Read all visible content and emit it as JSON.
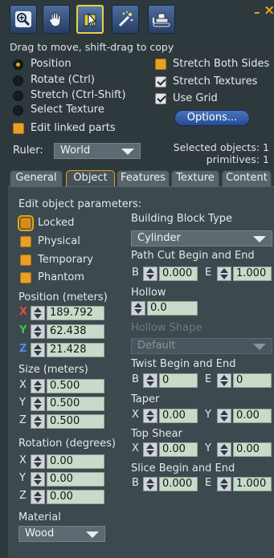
{
  "toolbar": {
    "tools": [
      {
        "icon": "magnify-icon"
      },
      {
        "icon": "grab-hand-icon"
      },
      {
        "icon": "edit-arrow-icon",
        "active": true
      },
      {
        "icon": "create-wand-icon"
      },
      {
        "icon": "bulldozer-icon"
      }
    ],
    "minimize_label": "–",
    "close_label": "×"
  },
  "hint": "Drag to move, shift-drag to copy",
  "edit_modes": [
    {
      "label": "Position",
      "selected": true
    },
    {
      "label": "Rotate (Ctrl)",
      "selected": false
    },
    {
      "label": "Stretch (Ctrl-Shift)",
      "selected": false
    },
    {
      "label": "Select Texture",
      "selected": false
    }
  ],
  "edit_linked_parts": {
    "label": "Edit linked parts",
    "checked": false
  },
  "stretch_options": [
    {
      "label": "Stretch Both Sides",
      "checked": false
    },
    {
      "label": "Stretch Textures",
      "checked": true
    },
    {
      "label": "Use Grid",
      "checked": true
    }
  ],
  "options_button": "Options...",
  "ruler": {
    "label": "Ruler:",
    "value": "World"
  },
  "selection": {
    "objects": "Selected objects: 1",
    "primitives": "primitives: 1"
  },
  "tabs": [
    "General",
    "Object",
    "Features",
    "Texture",
    "Content"
  ],
  "active_tab": "Object",
  "object": {
    "heading": "Edit object parameters:",
    "flags": [
      {
        "label": "Locked",
        "checked": false,
        "focused": true
      },
      {
        "label": "Physical",
        "checked": false
      },
      {
        "label": "Temporary",
        "checked": false
      },
      {
        "label": "Phantom",
        "checked": false
      }
    ],
    "position": {
      "label": "Position (meters)",
      "x": "189.792",
      "y": "62.438",
      "z": "21.428"
    },
    "size": {
      "label": "Size (meters)",
      "x": "0.500",
      "y": "0.500",
      "z": "0.500"
    },
    "rotation": {
      "label": "Rotation (degrees)",
      "x": "0.00",
      "y": "0.00",
      "z": "0.00"
    },
    "material": {
      "label": "Material",
      "value": "Wood"
    },
    "building_block": {
      "label": "Building Block Type",
      "value": "Cylinder"
    },
    "path_cut": {
      "label": "Path Cut Begin and End",
      "b_label": "B",
      "b": "0.000",
      "e_label": "E",
      "e": "1.000"
    },
    "hollow": {
      "label": "Hollow",
      "value": "0.0"
    },
    "hollow_shape": {
      "label": "Hollow Shape",
      "value": "Default"
    },
    "twist": {
      "label": "Twist Begin and End",
      "b_label": "B",
      "b": "0",
      "e_label": "E",
      "e": "0"
    },
    "taper": {
      "label": "Taper",
      "x_label": "X",
      "x": "0.00",
      "y_label": "Y",
      "y": "0.00"
    },
    "top_shear": {
      "label": "Top Shear",
      "x_label": "X",
      "x": "0.00",
      "y_label": "Y",
      "y": "0.00"
    },
    "slice": {
      "label": "Slice Begin and End",
      "b_label": "B",
      "b": "0.000",
      "e_label": "E",
      "e": "1.000"
    },
    "axis_labels": {
      "x": "X",
      "y": "Y",
      "z": "Z"
    }
  }
}
